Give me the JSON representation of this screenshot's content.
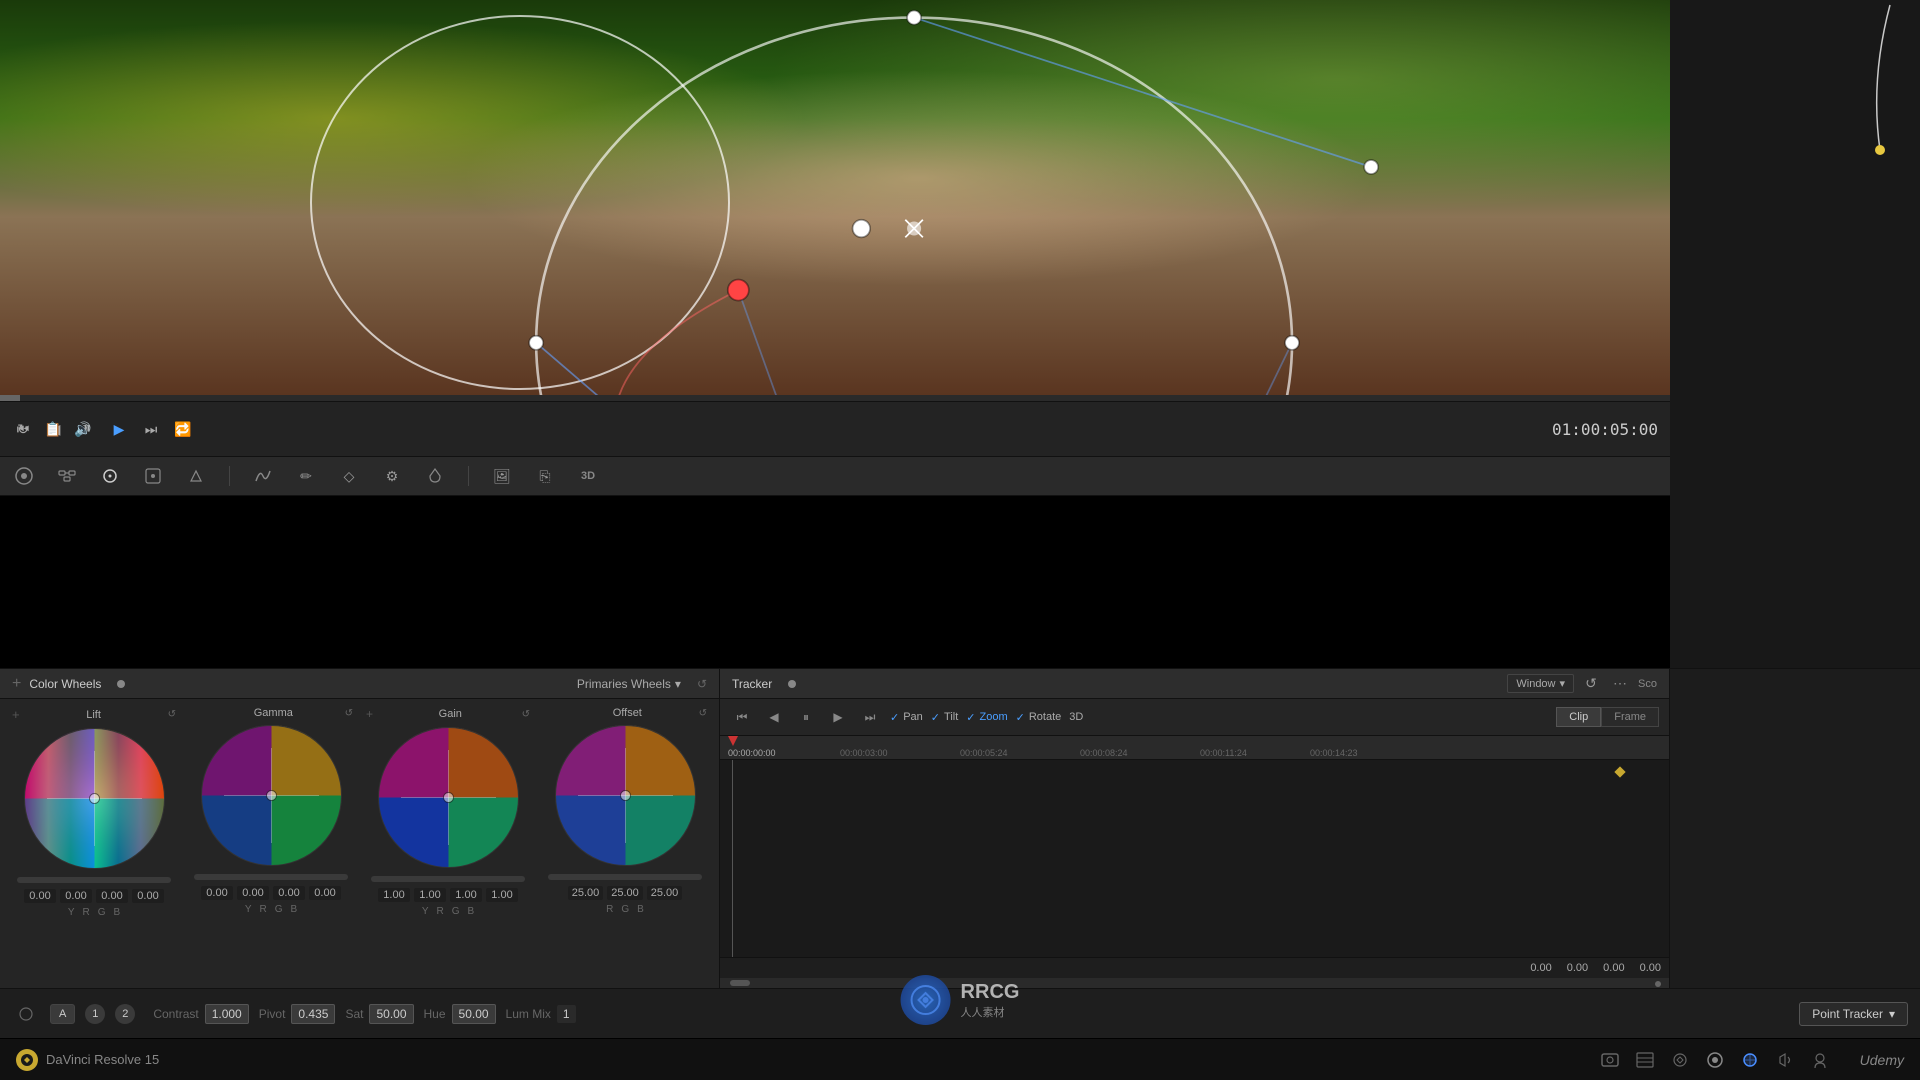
{
  "app": {
    "title": "DaVinci Resolve 15"
  },
  "video": {
    "timecode": "01:00:05:00"
  },
  "colorWheels": {
    "title": "Color Wheels",
    "dropdown": "Primaries Wheels",
    "wheels": [
      {
        "label": "Lift",
        "values": [
          "0.00",
          "0.00",
          "0.00",
          "0.00"
        ],
        "channels": [
          "Y",
          "R",
          "G",
          "B"
        ]
      },
      {
        "label": "Gamma",
        "values": [
          "0.00",
          "0.00",
          "0.00",
          "0.00"
        ],
        "channels": [
          "Y",
          "R",
          "G",
          "B"
        ]
      },
      {
        "label": "Gain",
        "values": [
          "1.00",
          "1.00",
          "1.00",
          "1.00"
        ],
        "channels": [
          "Y",
          "R",
          "G",
          "B"
        ]
      },
      {
        "label": "Offset",
        "values": [
          "25.00",
          "25.00",
          "25.00"
        ],
        "channels": [
          "R",
          "G",
          "B"
        ]
      }
    ]
  },
  "tracker": {
    "title": "Tracker",
    "options": {
      "pan": "Pan",
      "tilt": "Tilt",
      "zoom": "Zoom",
      "rotate": "Rotate",
      "threeD": "3D"
    },
    "tabs": {
      "clip": "Clip",
      "frame": "Frame"
    },
    "timestamps": [
      "00:00:00:00",
      "00:00:03:00",
      "00:00:05:24",
      "00:00:08:24",
      "00:00:11:24",
      "00:00:14:23"
    ],
    "values": [
      "0.00",
      "0.00",
      "0.00",
      "0.00"
    ],
    "window_btn": "Window"
  },
  "bottomBar": {
    "mode_a": "A",
    "mode_num1": "1",
    "mode_num2": "2",
    "contrast_label": "Contrast",
    "contrast_value": "1.000",
    "pivot_label": "Pivot",
    "pivot_value": "0.435",
    "sat_label": "Sat",
    "sat_value": "50.00",
    "hue_label": "Hue",
    "hue_value": "50.00",
    "lum_mix_label": "Lum Mix",
    "lum_mix_value": "1",
    "point_tracker": "Point Tracker"
  },
  "davinciBar": {
    "title": "DaVinci Resolve 15",
    "udemy": "Udemy"
  }
}
